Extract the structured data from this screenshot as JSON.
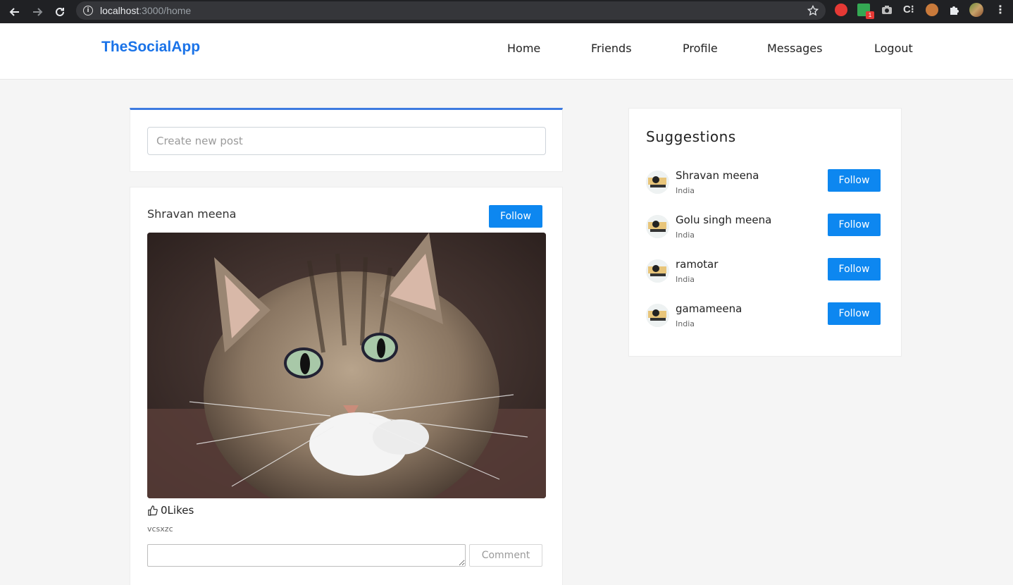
{
  "browser": {
    "url_host": "localhost",
    "url_path": ":3000/home",
    "extension_badge": "1"
  },
  "app": {
    "brand": "TheSocialApp",
    "nav": {
      "home": "Home",
      "friends": "Friends",
      "profile": "Profile",
      "messages": "Messages",
      "logout": "Logout"
    }
  },
  "create_post": {
    "placeholder": "Create new post"
  },
  "post": {
    "author": "Shravan meena",
    "follow_label": "Follow",
    "likes": "0Likes",
    "caption": "vcsxzc",
    "comment_placeholder": "",
    "comment_button": "Comment"
  },
  "suggestions": {
    "title": "Suggestions",
    "items": [
      {
        "name": "Shravan meena",
        "country": "India",
        "follow_label": "Follow"
      },
      {
        "name": "Golu singh meena",
        "country": "India",
        "follow_label": "Follow"
      },
      {
        "name": "ramotar",
        "country": "India",
        "follow_label": "Follow"
      },
      {
        "name": "gamameena",
        "country": "India",
        "follow_label": "Follow"
      }
    ]
  },
  "colors": {
    "brand": "#1a73e8",
    "primary_button": "#0d87f0",
    "accent_border": "#3d7be0",
    "page_background": "#f5f5f5"
  }
}
